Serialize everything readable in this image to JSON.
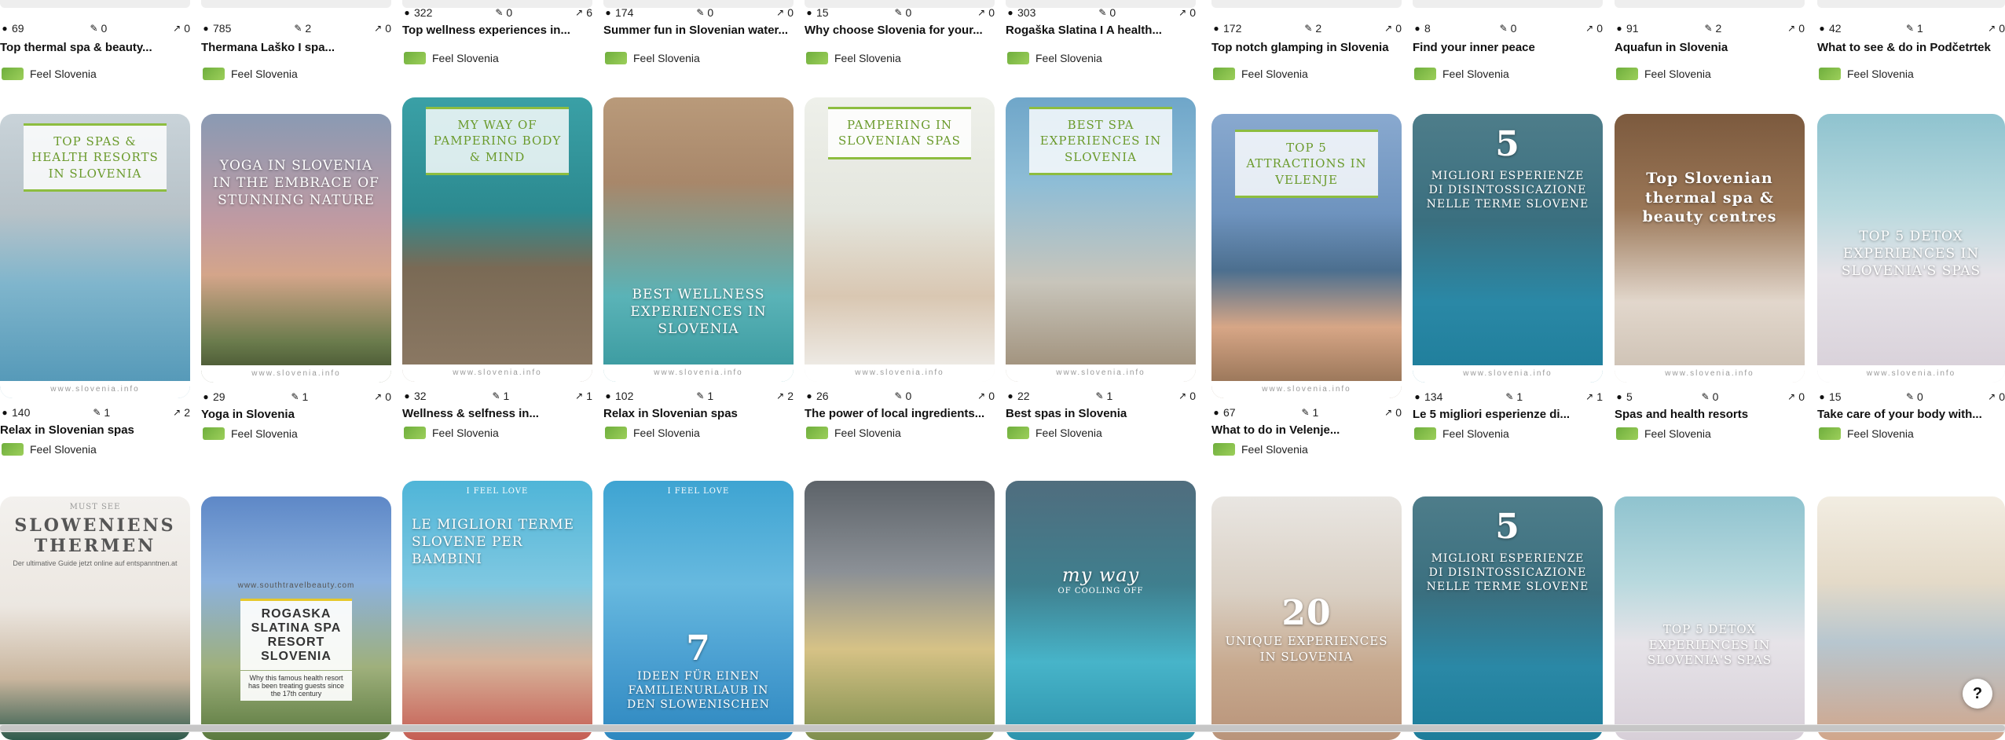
{
  "source_label": "Feel Slovenia",
  "footer_watermark": "www.slovenia.info",
  "help_label": "?",
  "columns": [
    {
      "top": {
        "views": "69",
        "pins": "0",
        "shares": "0",
        "title": "Top thermal spa & beauty..."
      },
      "mid": {
        "caption": "TOP SPAS & HEALTH RESORTS IN SLOVENIA",
        "views": "140",
        "pins": "1",
        "shares": "2",
        "title": "Relax in Slovenian spas"
      },
      "bot": {
        "caption": "SLOWENIENS THERMEN",
        "sub": "MUST SEE",
        "small": "Der ultimative Guide jetzt online auf entspanntnen.at"
      }
    },
    {
      "top": {
        "views": "785",
        "pins": "2",
        "shares": "0",
        "title": "Thermana Laško I spa..."
      },
      "mid": {
        "caption": "YOGA IN SLOVENIA IN THE EMBRACE OF STUNNING NATURE",
        "views": "29",
        "pins": "1",
        "shares": "0",
        "title": "Yoga in Slovenia"
      },
      "bot": {
        "caption": "ROGASKA SLATINA SPA RESORT SLOVENIA",
        "sub": "www.southtravelbeauty.com",
        "small": "Why this famous health resort has been treating guests since the 17th century"
      }
    },
    {
      "top": {
        "views": "322",
        "pins": "0",
        "shares": "6",
        "title": "Top wellness experiences in..."
      },
      "mid": {
        "caption": "MY WAY OF PAMPERING BODY & MIND",
        "views": "32",
        "pins": "1",
        "shares": "1",
        "title": "Wellness & selfness in..."
      },
      "bot": {
        "caption": "LE MIGLIORI TERME SLOVENE PER BAMBINI",
        "sub": "I FEEL LOVE"
      }
    },
    {
      "top": {
        "views": "174",
        "pins": "0",
        "shares": "0",
        "title": "Summer fun in Slovenian water..."
      },
      "mid": {
        "caption": "BEST WELLNESS EXPERIENCES IN SLOVENIA",
        "views": "102",
        "pins": "1",
        "shares": "2",
        "title": "Relax in Slovenian spas"
      },
      "bot": {
        "caption": "IDEEN FÜR EINEN FAMILIENURLAUB IN DEN SLOWENISCHEN",
        "sub": "I FEEL LOVE",
        "big": "7"
      }
    },
    {
      "top": {
        "views": "15",
        "pins": "0",
        "shares": "0",
        "title": "Why choose Slovenia for your..."
      },
      "mid": {
        "caption": "PAMPERING IN SLOVENIAN SPAS",
        "views": "26",
        "pins": "0",
        "shares": "0",
        "title": "The power of local ingredients..."
      },
      "bot": {
        "caption": ""
      }
    },
    {
      "top": {
        "views": "303",
        "pins": "0",
        "shares": "0",
        "title": "Rogaška Slatina I A health..."
      },
      "mid": {
        "caption": "BEST SPA EXPERIENCES IN SLOVENIA",
        "views": "22",
        "pins": "1",
        "shares": "0",
        "title": "Best spas in Slovenia"
      },
      "bot": {
        "caption": "my way",
        "sub": "OF COOLING OFF"
      }
    },
    {
      "top": {
        "views": "172",
        "pins": "2",
        "shares": "0",
        "title": "Top notch glamping in Slovenia"
      },
      "mid": {
        "caption": "TOP 5 ATTRACTIONS IN VELENJE",
        "views": "67",
        "pins": "1",
        "shares": "0",
        "title": "What to do in Velenje..."
      },
      "bot": {
        "caption": "UNIQUE EXPERIENCES IN SLOVENIA",
        "big": "20"
      }
    },
    {
      "top": {
        "views": "8",
        "pins": "0",
        "shares": "0",
        "title": "Find your inner peace"
      },
      "mid": {
        "caption": "MIGLIORI ESPERIENZE DI DISINTOSSICAZIONE NELLE TERME SLOVENE",
        "big": "5",
        "views": "134",
        "pins": "1",
        "shares": "1",
        "title": "Le 5 migliori esperienze di..."
      },
      "bot": {
        "caption": "MIGLIORI ESPERIENZE DI DISINTOSSICAZIONE NELLE TERME SLOVENE",
        "big": "5"
      }
    },
    {
      "top": {
        "views": "91",
        "pins": "2",
        "shares": "0",
        "title": "Aquafun in Slovenia"
      },
      "mid": {
        "caption": "Top Slovenian thermal spa & beauty centres",
        "views": "5",
        "pins": "0",
        "shares": "0",
        "title": "Spas and health resorts"
      },
      "bot": {
        "caption": "TOP 5 DETOX EXPERIENCES IN SLOVENIA'S SPAS"
      }
    },
    {
      "top": {
        "views": "42",
        "pins": "1",
        "shares": "0",
        "title": "What to see & do in Podčetrtek"
      },
      "mid": {
        "caption": "TOP 5 DETOX EXPERIENCES IN SLOVENIA'S SPAS",
        "views": "15",
        "pins": "0",
        "shares": "0",
        "title": "Take care of your body with..."
      },
      "bot": {
        "caption": ""
      }
    }
  ]
}
